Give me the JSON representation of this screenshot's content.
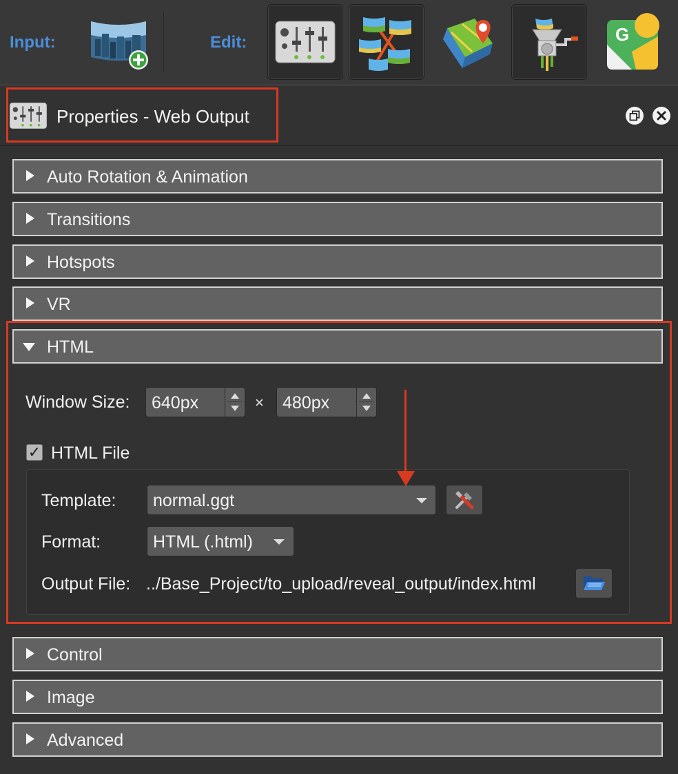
{
  "toolbar": {
    "input_label": "Input:",
    "edit_label": "Edit:",
    "buttons": [
      {
        "icon": "add-panorama-icon"
      },
      {
        "icon": "properties-sliders-icon"
      },
      {
        "icon": "tour-browser-icon"
      },
      {
        "icon": "map-pin-icon"
      },
      {
        "icon": "grinder-icon"
      },
      {
        "icon": "google-street-view-icon"
      }
    ]
  },
  "panel": {
    "title": "Properties - Web Output",
    "float_icon": "float-window-icon",
    "close_icon": "close-icon"
  },
  "sections": {
    "auto_rotation": "Auto Rotation & Animation",
    "transitions": "Transitions",
    "hotspots": "Hotspots",
    "vr": "VR",
    "html": "HTML",
    "control": "Control",
    "image": "Image",
    "advanced": "Advanced"
  },
  "html": {
    "window_size_label": "Window Size:",
    "width_value": "640px",
    "times": "×",
    "height_value": "480px",
    "html_file_checkbox_label": "HTML File",
    "html_file_checked": "✓",
    "template_label": "Template:",
    "template_value": "normal.ggt",
    "format_label": "Format:",
    "format_value": "HTML (.html)",
    "output_file_label": "Output File:",
    "output_file_value": "../Base_Project/to_upload/reveal_output/index.html"
  },
  "colors": {
    "highlight": "#d83a21",
    "accent_label": "#4a8fd9",
    "section_bg": "#626262",
    "panel_bg": "#323232"
  }
}
